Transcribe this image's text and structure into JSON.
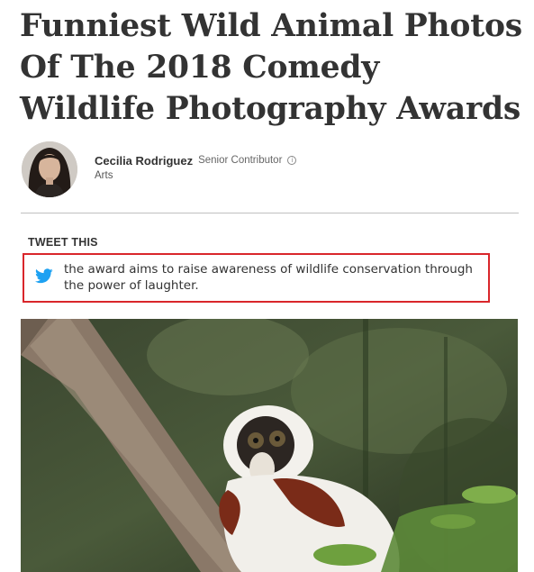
{
  "article": {
    "headline": "Funniest Wild Animal Photos Of The 2018 Comedy Wildlife Photography Awards"
  },
  "author": {
    "name": "Cecilia Rodriguez",
    "title": "Senior Contributor",
    "section": "Arts",
    "info_icon": "info-icon"
  },
  "tweet_this": {
    "label": "TWEET THIS",
    "text": "the award aims to raise awareness of wildlife conservation through the power of laughter.",
    "icon": "twitter-icon",
    "brand_color": "#1da1f2",
    "highlight_border_color": "#d9262b"
  },
  "photo": {
    "subject": "lemur"
  }
}
